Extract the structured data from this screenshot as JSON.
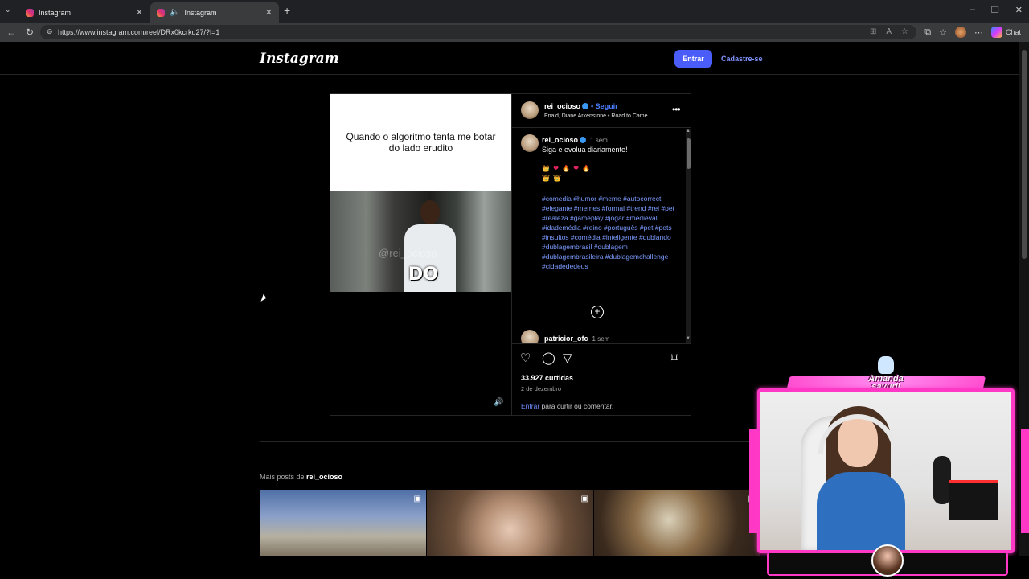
{
  "browser": {
    "tabs": [
      {
        "title": "Instagram",
        "active": false
      },
      {
        "title": "Instagram",
        "active": true
      }
    ],
    "url": "https://www.instagram.com/reel/DRx0kcrku27/?l=1",
    "chat_label": "Chat"
  },
  "header": {
    "logo": "Instagram",
    "login_button": "Entrar",
    "signup_link": "Cadastre-se",
    "accent_color": "#4a5df9"
  },
  "post": {
    "meme_caption": "Quando o algoritmo tenta me botar do lado erudito",
    "meme_watermark": "@rei_ocioso",
    "meme_subtitle": "DO",
    "author": {
      "username": "rei_ocioso",
      "follow_label": "• Seguir",
      "audio": "Enaid, Diane Arkenstone • Road to Came..."
    },
    "caption": {
      "username": "rei_ocioso",
      "time": "1 sem",
      "text": "Siga e evolua diariamente!",
      "hashtags": "#comedia #humor #meme #autocorrect #elegante #memes #formal #trend #rei #pet #realeza #gameplay #jogar #medieval #idademédia #reino #português #pet #pets #insultos #comédia #inteligente #dublando #dublagembrasil #dublagem #dublagembrasileira #dublagemchallenge #cidadededeus"
    },
    "next_comment": {
      "username": "patricior_ofc",
      "time": "1 sem"
    },
    "likes": "33.927 curtidas",
    "date": "2 de dezembro",
    "login_prompt_link": "Entrar",
    "login_prompt_text": " para curtir ou comentar."
  },
  "more_posts": {
    "prefix": "Mais posts de ",
    "username": "rei_ocioso"
  },
  "stream_overlay": {
    "name": "Amanda sayurii"
  }
}
